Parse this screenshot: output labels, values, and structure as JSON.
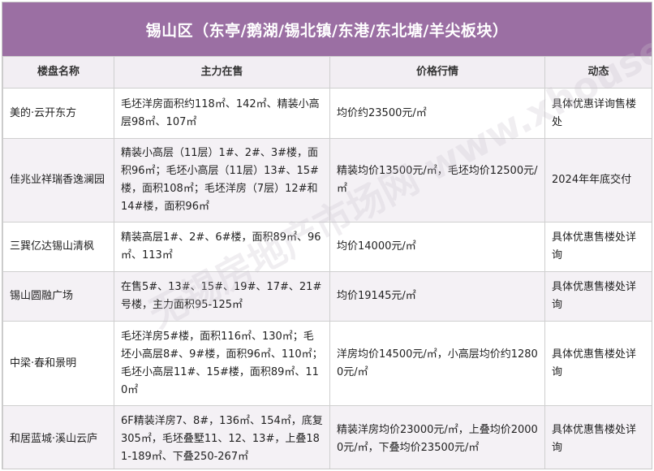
{
  "title": "锡山区（东亭/鹅湖/锡北镇/东港/东北塘/羊尖板块）",
  "columns": [
    "楼盘名称",
    "主力在售",
    "价格行情",
    "动态"
  ],
  "rows": [
    {
      "name": "美的·云开东方",
      "sale": "毛坯洋房面积约118㎡、142㎡、精装小高层98㎡、107㎡",
      "price": "均价约23500元/㎡",
      "status": "具体优惠详询售楼处"
    },
    {
      "name": "佳兆业祥瑞香逸澜园",
      "sale": "精装小高层（11层）1#、2#、3#楼，面积96㎡；毛坯小高层（11层）13#、15#楼，面积108㎡；毛坯洋房（7层）12#和14#楼，面积96㎡",
      "price": "精装均价13500元/㎡，毛坯均价12500元/㎡",
      "status": "2024年年底交付"
    },
    {
      "name": "三巽亿达锡山清枫",
      "sale": "精装高层1#、2#、6#楼，面积89㎡、96㎡、113㎡",
      "price": "均价14000元/㎡",
      "status": "具体优惠售楼处详询"
    },
    {
      "name": "锡山圆融广场",
      "sale": "在售5#、13#、15#、19#、17#、21#号楼，主力面积95-125㎡",
      "price": "均价19145元/㎡",
      "status": "具体优惠售楼处详询"
    },
    {
      "name": "中梁·春和景明",
      "sale": "毛坯洋房5#楼，面积116㎡、130㎡；毛坯小高层8#、9#楼，面积96㎡、110㎡；毛坯小高层11#、15#楼，面积89㎡、110㎡",
      "price": "洋房均价14500元/㎡，小高层均价约12800元/㎡",
      "status": "具体优惠售楼处详询"
    },
    {
      "name": "和居蓝城·溪山云庐",
      "sale": "6F精装洋房7、8#，136㎡、154㎡，底复305㎡，毛坯叠墅11、12、13#，上叠181-189㎡、下叠250-267㎡",
      "price": "精装洋房均价23000元/㎡，上叠均价20000元/㎡，下叠均价23500元/㎡",
      "status": "具体优惠售楼处详询"
    }
  ],
  "watermark": "无锡房地产市场网 www.xhouse.com"
}
